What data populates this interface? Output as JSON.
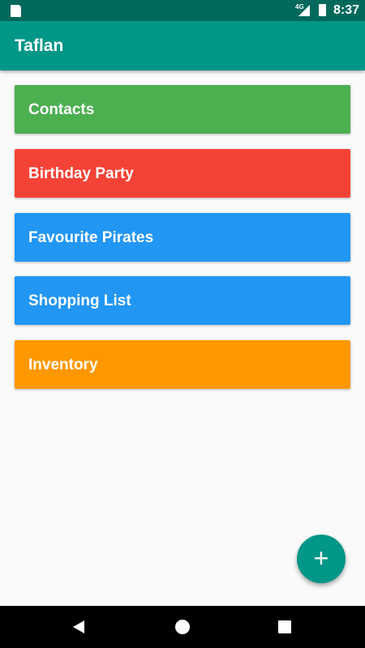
{
  "status_bar": {
    "time": "8:37",
    "network": "4G",
    "icons": [
      "sd-card-icon",
      "signal-icon",
      "battery-charging-icon"
    ]
  },
  "app_bar": {
    "title": "Taflan"
  },
  "lists": [
    {
      "label": "Contacts",
      "color": "#4caf50"
    },
    {
      "label": "Birthday Party",
      "color": "#f44336"
    },
    {
      "label": "Favourite Pirates",
      "color": "#2196f3"
    },
    {
      "label": "Shopping List",
      "color": "#2196f3"
    },
    {
      "label": "Inventory",
      "color": "#ff9800"
    }
  ],
  "fab": {
    "label": "+",
    "color": "#009688"
  }
}
